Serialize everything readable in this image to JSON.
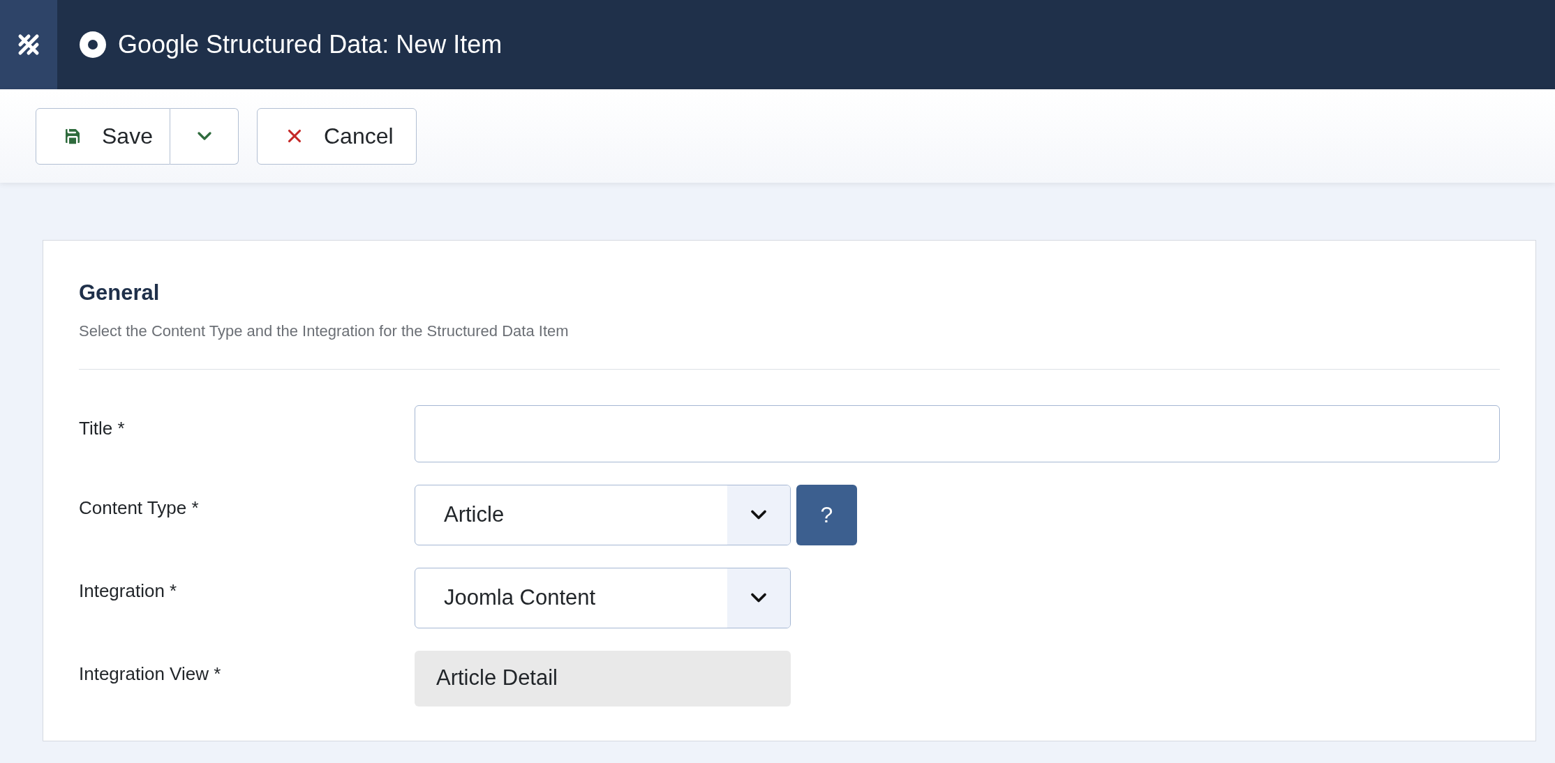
{
  "header": {
    "title": "Google Structured Data: New Item"
  },
  "toolbar": {
    "save": "Save",
    "cancel": "Cancel"
  },
  "section": {
    "title": "General",
    "description": "Select the Content Type and the Integration for the Structured Data Item"
  },
  "fields": [
    {
      "kind": "text",
      "label": "Title *"
    },
    {
      "kind": "select",
      "label": "Content Type *",
      "value": "Article",
      "help": "?"
    },
    {
      "kind": "select",
      "label": "Integration *",
      "value": "Joomla Content"
    },
    {
      "kind": "readonly",
      "label": "Integration View *",
      "value": "Article Detail"
    }
  ]
}
